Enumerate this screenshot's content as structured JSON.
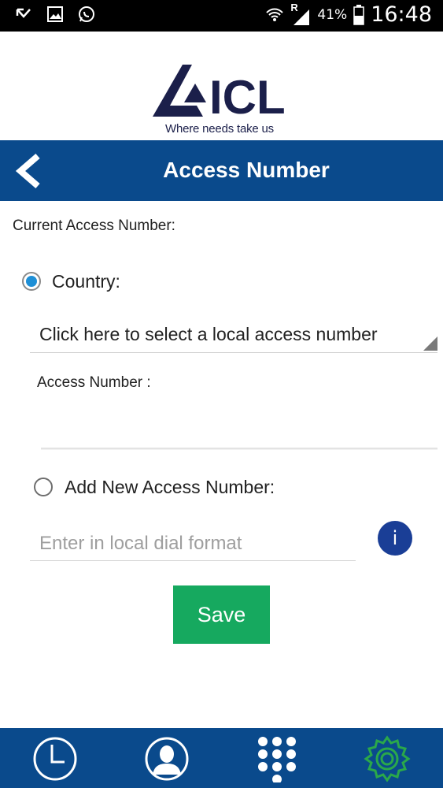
{
  "status_bar": {
    "icons": [
      "missed-call-icon",
      "gallery-icon",
      "whatsapp-icon",
      "wifi-icon",
      "roaming-signal-icon",
      "battery-icon"
    ],
    "roaming_indicator": "R",
    "battery_percent": "41%",
    "time": "16:48"
  },
  "brand": {
    "logo_text": "ICL",
    "tagline": "Where needs take us",
    "color": "#1b1f4a"
  },
  "header": {
    "back_icon": "back-arrow-icon",
    "title": "Access Number",
    "color": "#0a4a8c"
  },
  "current": {
    "label": "Current Access Number:"
  },
  "country_option": {
    "label": "Country:",
    "selected": true,
    "spinner_text": "Click here to select a local access number",
    "access_number_label": "Access Number :",
    "access_number_value": ""
  },
  "add_option": {
    "label": "Add New Access Number:",
    "selected": false,
    "input_placeholder": "Enter in local dial format",
    "info_label": "i",
    "info_color": "#1a3e96"
  },
  "save": {
    "label": "Save",
    "color": "#16a95f"
  },
  "bottom_nav": {
    "items": [
      {
        "icon": "clock-icon",
        "active": false
      },
      {
        "icon": "contacts-icon",
        "active": false
      },
      {
        "icon": "dialpad-icon",
        "active": false
      },
      {
        "icon": "gear-icon",
        "active": true
      }
    ],
    "active_color": "#2aa84a"
  }
}
